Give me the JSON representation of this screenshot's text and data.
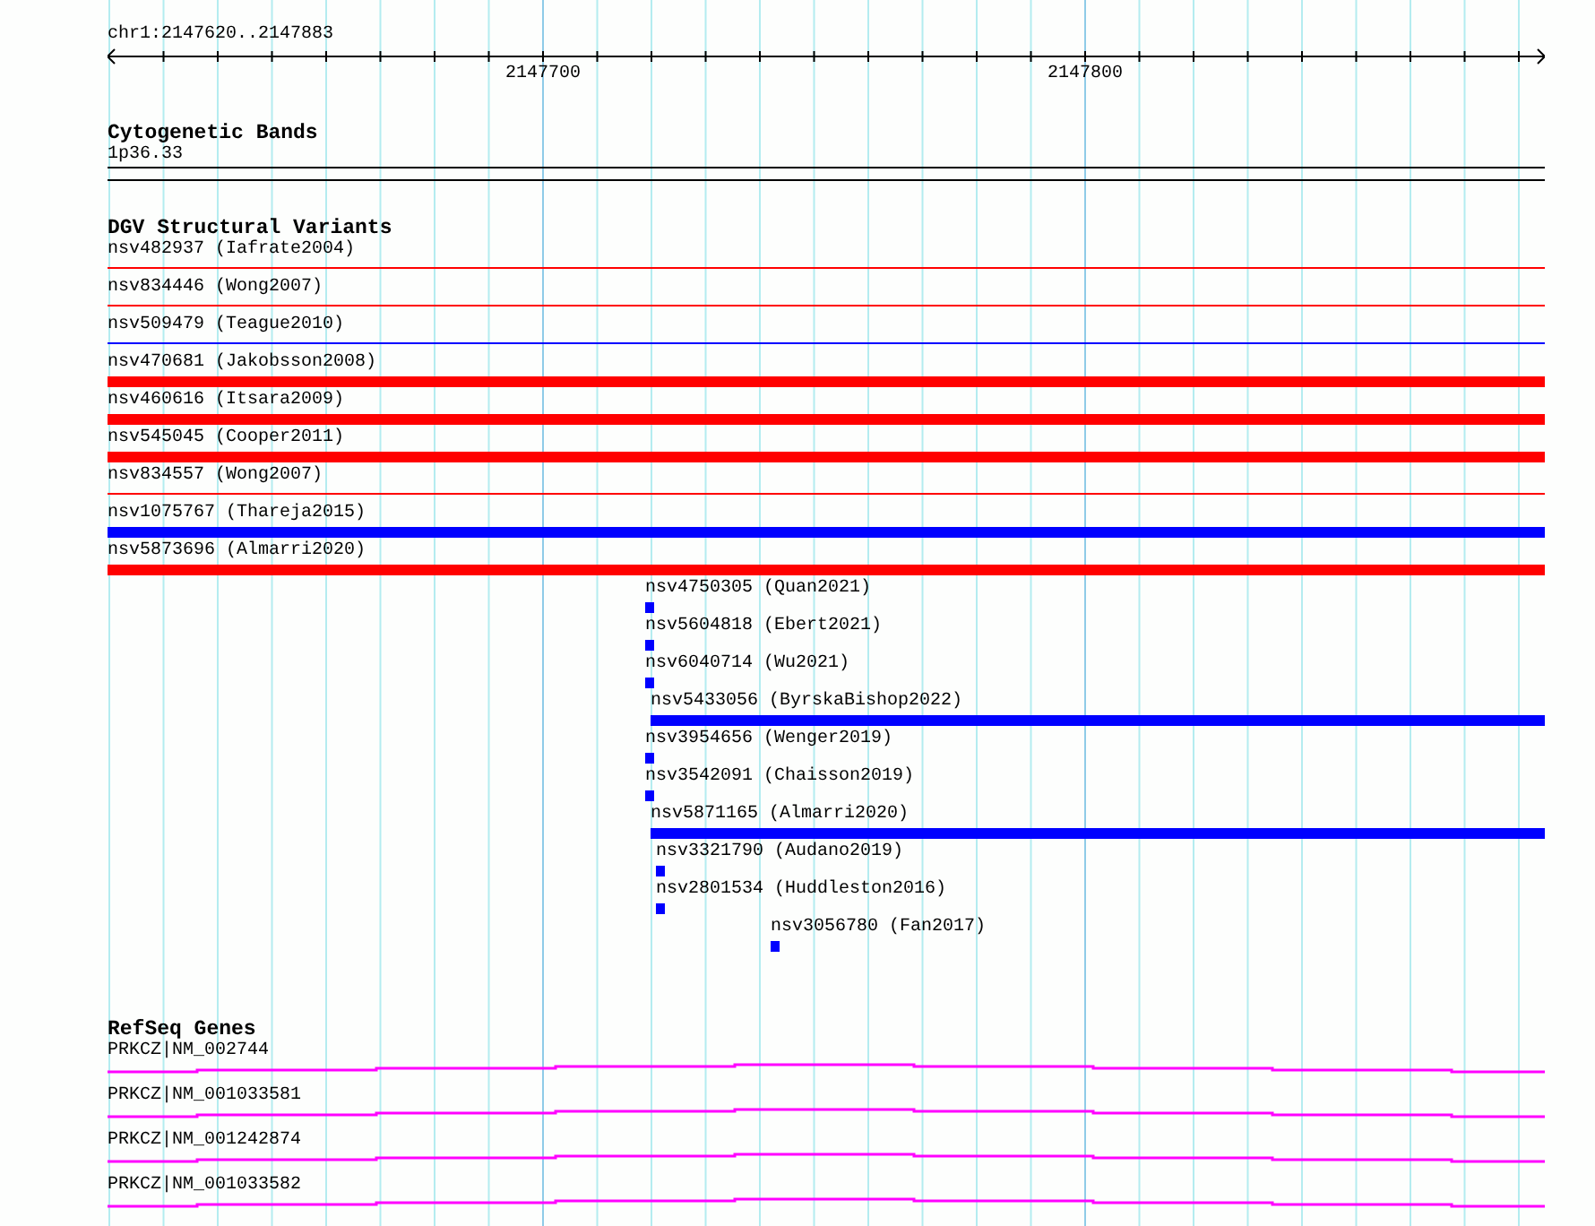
{
  "ruler": {
    "position": "chr1:2147620..2147883",
    "tick_labels": [
      "2147700",
      "2147800"
    ]
  },
  "tracks": [
    {
      "kind": "bands",
      "title": "Cytogenetic Bands",
      "items": [
        {
          "label": "1p36.33"
        }
      ]
    },
    {
      "kind": "variants",
      "title": "DGV Structural Variants",
      "items": [
        {
          "label": "nsv482937 (Iafrate2004)",
          "kind": "line",
          "color": "#ff0000"
        },
        {
          "label": "nsv834446 (Wong2007)",
          "kind": "line",
          "color": "#ff0000"
        },
        {
          "label": "nsv509479 (Teague2010)",
          "kind": "line",
          "color": "#0000ff"
        },
        {
          "label": "nsv470681 (Jakobsson2008)",
          "kind": "bar",
          "color": "#ff0000"
        },
        {
          "label": "nsv460616 (Itsara2009)",
          "kind": "bar",
          "color": "#ff0000"
        },
        {
          "label": "nsv545045 (Cooper2011)",
          "kind": "bar",
          "color": "#ff0000"
        },
        {
          "label": "nsv834557 (Wong2007)",
          "kind": "line",
          "color": "#ff0000"
        },
        {
          "label": "nsv1075767 (Thareja2015)",
          "kind": "bar",
          "color": "#0000ff"
        },
        {
          "label": "nsv5873696 (Almarri2020)",
          "kind": "bar",
          "color": "#ff0000"
        },
        {
          "label": "nsv4750305 (Quan2021)",
          "kind": "bar",
          "color": "#0000ff"
        },
        {
          "label": "nsv5604818 (Ebert2021)",
          "kind": "bar",
          "color": "#0000ff"
        },
        {
          "label": "nsv6040714 (Wu2021)",
          "kind": "bar",
          "color": "#0000ff"
        },
        {
          "label": "nsv5433056 (ByrskaBishop2022)",
          "kind": "bar",
          "color": "#0000ff"
        },
        {
          "label": "nsv3954656 (Wenger2019)",
          "kind": "bar",
          "color": "#0000ff"
        },
        {
          "label": "nsv3542091 (Chaisson2019)",
          "kind": "bar",
          "color": "#0000ff"
        },
        {
          "label": "nsv5871165 (Almarri2020)",
          "kind": "bar",
          "color": "#0000ff"
        },
        {
          "label": "nsv3321790 (Audano2019)",
          "kind": "bar",
          "color": "#0000ff"
        },
        {
          "label": "nsv2801534 (Huddleston2016)",
          "kind": "bar",
          "color": "#0000ff"
        },
        {
          "label": "nsv3056780 (Fan2017)",
          "kind": "bar",
          "color": "#0000ff"
        }
      ]
    },
    {
      "kind": "genes",
      "title": "RefSeq Genes",
      "items": [
        {
          "label": "PRKCZ|NM_002744"
        },
        {
          "label": "PRKCZ|NM_001033581"
        },
        {
          "label": "PRKCZ|NM_001242874"
        },
        {
          "label": "PRKCZ|NM_001033582"
        }
      ]
    }
  ]
}
